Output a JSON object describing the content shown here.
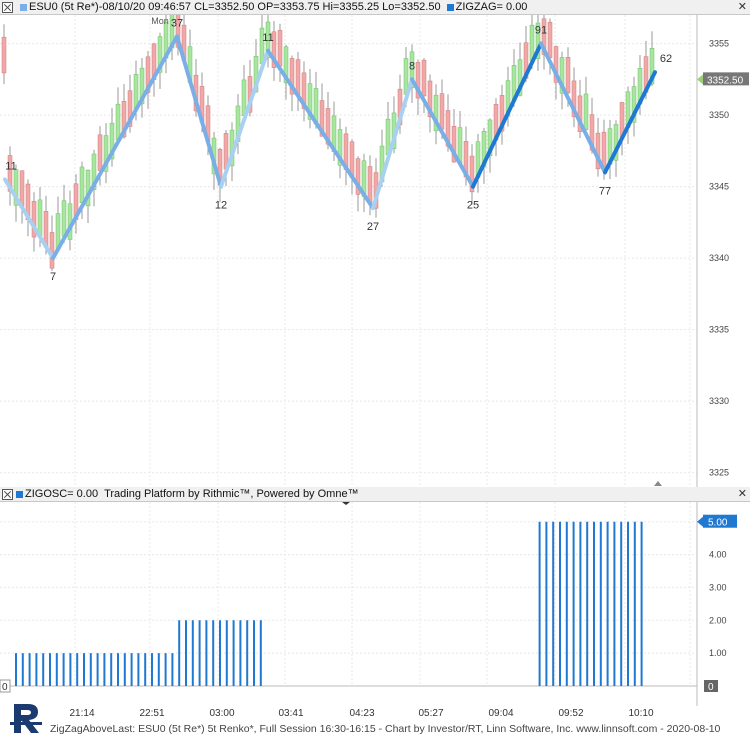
{
  "header_main": {
    "symbol_text": "ESU0 (5t Re*)-08/10/20 09:46:57 CL=3352.50 OP=3353.75 Hi=3355.25 Lo=3352.50",
    "indicator_text": "ZIGZAG= 0.00"
  },
  "header_osc": {
    "indicator_text": "ZIGOSC= 0.00",
    "platform_text": "Trading Platform by Rithmic™, Powered by Omne™"
  },
  "colors": {
    "up_candle": "#a8e6a0",
    "down_candle": "#f0a8a8",
    "zigzag_light": "#a8d0f0",
    "zigzag_mid": "#7aaee6",
    "zigzag_dark": "#1f78d1",
    "osc_bar": "#1f78d1"
  },
  "chart_data": [
    {
      "type": "line",
      "title": "",
      "price_axis_ticks": [
        "3355",
        "3350",
        "3345",
        "3340",
        "3335",
        "3330",
        "3325"
      ],
      "ylim": [
        3324,
        3357
      ],
      "day_marker": "Mon",
      "last_price_label": "3352.50",
      "zigzag_pivots": [
        {
          "label": "11",
          "price": 3345.5
        },
        {
          "label": "7",
          "price": 3340.0
        },
        {
          "label": "37",
          "price": 3355.5
        },
        {
          "label": "12",
          "price": 3345.0
        },
        {
          "label": "11",
          "price": 3354.5
        },
        {
          "label": "27",
          "price": 3343.5
        },
        {
          "label": "8",
          "price": 3352.5
        },
        {
          "label": "25",
          "price": 3345.0
        },
        {
          "label": "91",
          "price": 3355.0
        },
        {
          "label": "77",
          "price": 3346.0
        },
        {
          "label": "62",
          "price": 3353.0
        }
      ]
    },
    {
      "type": "bar",
      "title": "",
      "osc_axis_ticks": [
        "5.00",
        "4.00",
        "3.00",
        "2.00",
        "1.00",
        "0"
      ],
      "ylim": [
        0,
        5.6
      ],
      "current_label": "5.00",
      "zero_label": "0",
      "left_zero_label": "0",
      "segments": [
        {
          "value": 1,
          "count": 24
        },
        {
          "value": 2,
          "count": 13
        },
        {
          "value": 0,
          "count": 40
        },
        {
          "value": 5,
          "count": 16
        }
      ]
    }
  ],
  "time_axis": [
    "21:14",
    "22:51",
    "03:00",
    "03:41",
    "04:23",
    "05:27",
    "09:04",
    "09:52",
    "10:10"
  ],
  "footer": "ZigZagAboveLast: ESU0 (5t Re*) 5t Renko*, Full Session 16:30-16:15 - Chart by Investor/RT, Linn Software, Inc. www.linnsoft.com - 2020-08-10"
}
